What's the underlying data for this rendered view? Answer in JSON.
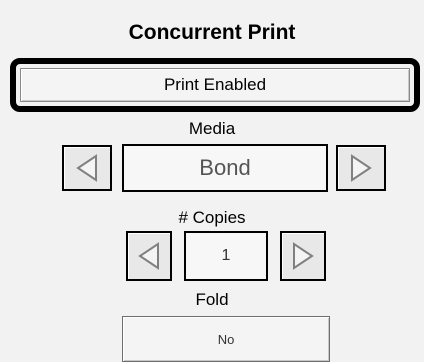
{
  "title": "Concurrent Print",
  "status_button": {
    "label": "Print Enabled"
  },
  "media": {
    "label": "Media",
    "value": "Bond",
    "prev_icon": "left-triangle-icon",
    "next_icon": "right-triangle-icon"
  },
  "copies": {
    "label": "# Copies",
    "value": "1",
    "prev_icon": "left-triangle-icon",
    "next_icon": "right-triangle-icon"
  },
  "fold": {
    "label": "Fold",
    "value": "No"
  },
  "colors": {
    "panel_bg": "#f2f2f2",
    "border": "#000000",
    "arrow_outline": "#808080"
  }
}
